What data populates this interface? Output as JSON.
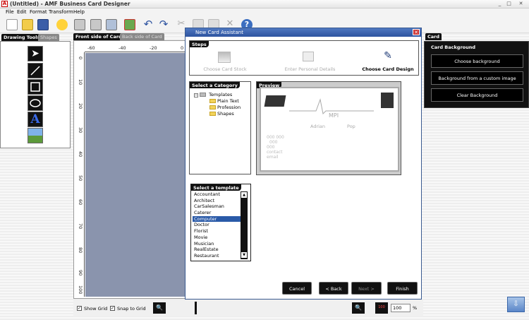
{
  "window": {
    "title": "(Untitled) - AMF Business Card Designer"
  },
  "menu": [
    "File",
    "Edit",
    "Format",
    "Transform",
    "Help"
  ],
  "left_panel": {
    "tabs": [
      "Drawing Tools",
      "Shapes"
    ]
  },
  "canvas": {
    "tabs": [
      "Front side of Card",
      "Back side of Card"
    ],
    "ruler_labels": [
      "-60",
      "-40",
      "-20",
      "0"
    ],
    "ruler_left_labels": [
      "0",
      "10",
      "20",
      "30",
      "40",
      "50",
      "60",
      "70",
      "80",
      "90",
      "100"
    ]
  },
  "bottom_bar": {
    "show_grid": "Show Grid",
    "snap_to_grid": "Snap to Grid",
    "zoom_value": "100",
    "zoom_unit": "%"
  },
  "dialog": {
    "title": "New Card Assistant",
    "steps_header": "Steps",
    "steps": [
      "Choose Card Stock",
      "Enter Personal Details",
      "Choose Card Design"
    ],
    "category_header": "Select a Category",
    "tree": {
      "root": "Templates",
      "children": [
        "Plain Text",
        "Profession",
        "Shapes"
      ]
    },
    "preview_header": "Preview",
    "preview": {
      "company": "MPI",
      "first": "Adrian",
      "last": "Pop",
      "lines": [
        "000 000",
        "000",
        "000",
        "contact",
        "email"
      ]
    },
    "template_header": "Select a template",
    "templates": [
      "Accountant",
      "Architect",
      "CarSalesman",
      "Caterer",
      "Computer",
      "Doctor",
      "Florist",
      "Movie",
      "Musician",
      "RealEstate",
      "Restaurant"
    ],
    "selected_template": "Computer",
    "buttons": {
      "cancel": "Cancel",
      "back": "< Back",
      "next": "Next >",
      "finish": "Finish"
    }
  },
  "right_panel": {
    "tab": "Card",
    "header": "Card Background",
    "buttons": [
      "Choose background",
      "Background from a custom image",
      "Clear Background"
    ]
  }
}
